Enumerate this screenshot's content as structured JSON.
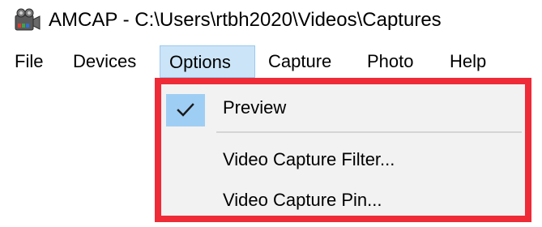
{
  "window": {
    "app_icon": "camcorder-icon",
    "title": "AMCAP - C:\\Users\\rtbh2020\\Videos\\Captures"
  },
  "menubar": {
    "items": [
      {
        "label": "File"
      },
      {
        "label": "Devices"
      },
      {
        "label": "Options",
        "active": true
      },
      {
        "label": "Capture"
      },
      {
        "label": "Photo"
      },
      {
        "label": "Help"
      }
    ]
  },
  "options_menu": {
    "highlight_color": "#ee2b37",
    "items": [
      {
        "label": "Preview",
        "checked": true,
        "check_icon": "checkmark-icon"
      },
      {
        "label": "Video Capture Filter..."
      },
      {
        "label": "Video Capture Pin..."
      }
    ]
  }
}
